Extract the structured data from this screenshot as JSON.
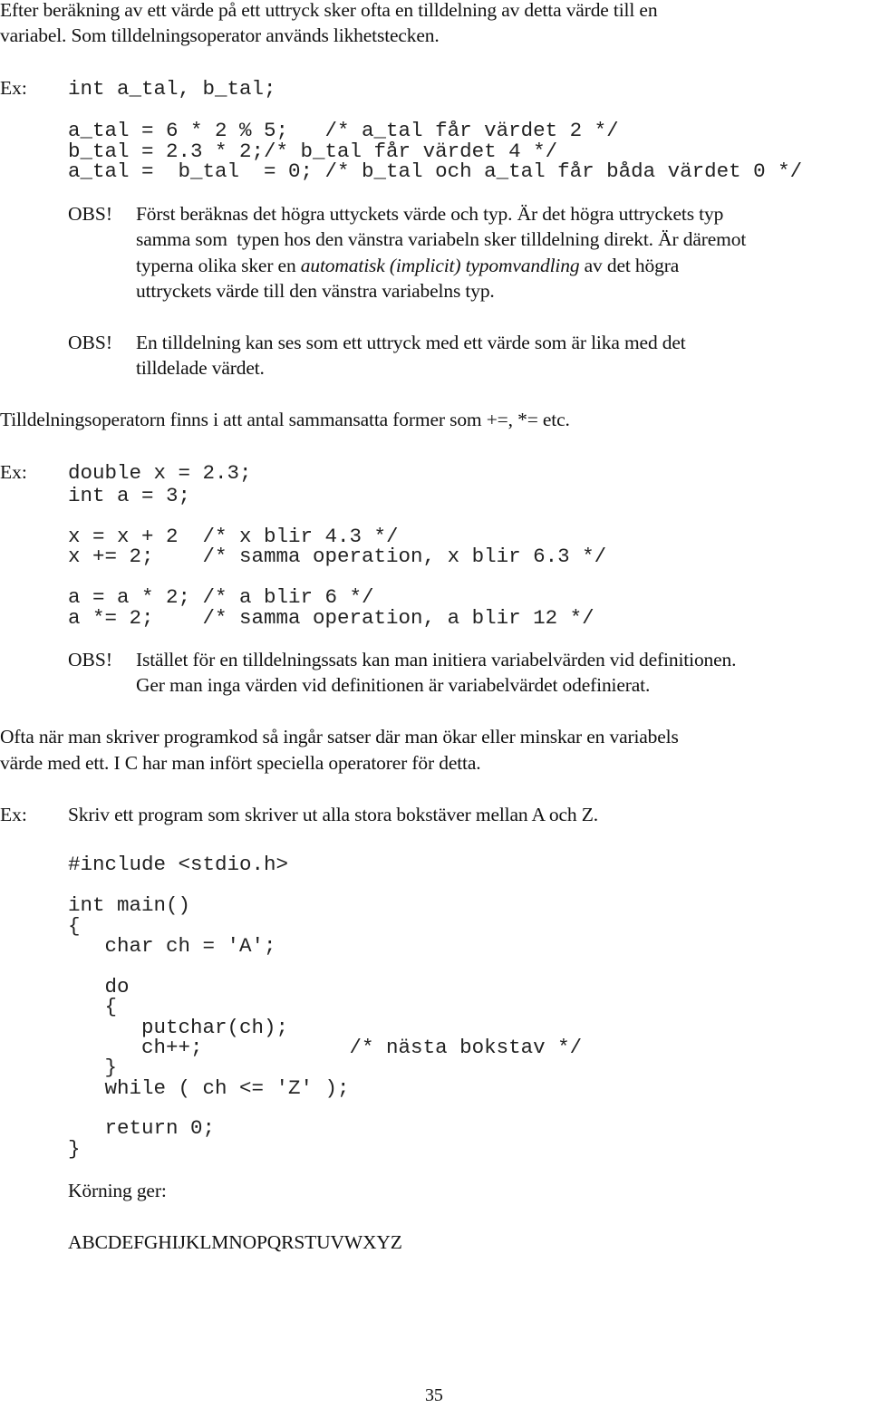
{
  "intro": {
    "line1": "Efter beräkning av ett värde på ett uttryck sker ofta en tilldelning av detta värde till en",
    "line2": "variabel. Som tilldelningsoperator används likhetstecken."
  },
  "example1": {
    "label": "Ex:",
    "code": [
      "int a_tal, b_tal;",
      "a_tal = 6 * 2 % 5;   /* a_tal får värdet 2 */",
      "b_tal = 2.3 * 2;/* b_tal får värdet 4 */",
      "a_tal =  b_tal  = 0; /* b_tal och a_tal får båda värdet 0 */"
    ]
  },
  "obs1": {
    "label": "OBS!",
    "line1": "Först beräknas det högra uttyckets värde och typ. Är det högra uttryckets typ",
    "line2": "samma som  typen hos den vänstra variabeln sker tilldelning direkt. Är däremot",
    "line3_pre": "typerna olika sker en ",
    "line3_em": "automatisk (implicit) typomvandling",
    "line3_post": " av det högra",
    "line4": "uttryckets värde till den vänstra variabelns typ."
  },
  "obs2": {
    "label": "OBS!",
    "line1": "En tilldelning kan ses som ett uttryck med ett värde som är lika med det",
    "line2": "tilldelade värdet."
  },
  "compound": {
    "text": "Tilldelningsoperatorn finns i att antal sammansatta former som +=, *= etc."
  },
  "example2": {
    "label": "Ex:",
    "code": [
      "double x = 2.3;",
      "int a = 3;",
      "x = x + 2  /* x blir 4.3 */",
      "x += 2;    /* samma operation, x blir 6.3 */",
      "a = a * 2; /* a blir 6 */",
      "a *= 2;    /* samma operation, a blir 12 */"
    ]
  },
  "obs3": {
    "label": "OBS!",
    "line1": "Istället för en tilldelningssats kan man initiera variabelvärden vid definitionen.",
    "line2": "Ger man inga värden vid definitionen är variabelvärdet odefinierat."
  },
  "increment": {
    "line1": "Ofta när man skriver programkod så ingår satser där man ökar eller minskar en variabels",
    "line2": "värde med ett. I C har man infört speciella operatorer för detta."
  },
  "example3": {
    "label": "Ex:",
    "task": "Skriv ett program som skriver ut alla stora bokstäver mellan A och Z.",
    "code": [
      "#include <stdio.h>",
      "int main()",
      "{",
      "   char ch = 'A';",
      "   do",
      "   {",
      "      putchar(ch);",
      "      ch++;            /* nästa bokstav */",
      "   }",
      "   while ( ch <= 'Z' );",
      "   return 0;",
      "}"
    ],
    "run_label": "Körning ger:",
    "output": "ABCDEFGHIJKLMNOPQRSTUVWXYZ"
  },
  "page_number": "35"
}
